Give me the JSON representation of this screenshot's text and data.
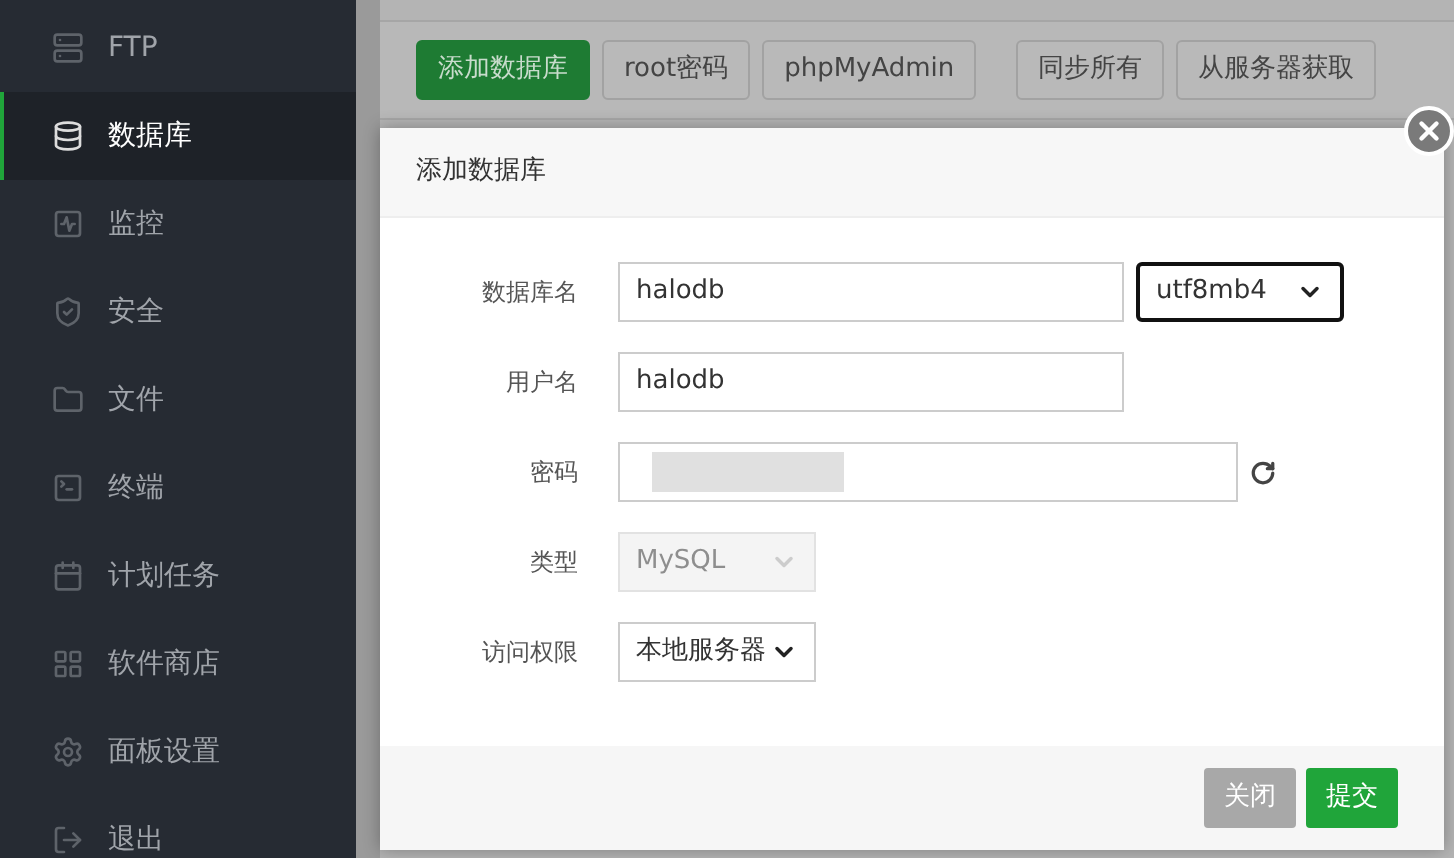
{
  "sidebar": {
    "items": [
      {
        "label": "FTP",
        "selected": false
      },
      {
        "label": "数据库",
        "selected": true
      },
      {
        "label": "监控",
        "selected": false
      },
      {
        "label": "安全",
        "selected": false
      },
      {
        "label": "文件",
        "selected": false
      },
      {
        "label": "终端",
        "selected": false
      },
      {
        "label": "计划任务",
        "selected": false
      },
      {
        "label": "软件商店",
        "selected": false
      },
      {
        "label": "面板设置",
        "selected": false
      },
      {
        "label": "退出",
        "selected": false
      }
    ]
  },
  "toolbar": {
    "groups": [
      [
        {
          "label": "添加数据库",
          "kind": "primary"
        },
        {
          "label": "root密码",
          "kind": "default"
        },
        {
          "label": "phpMyAdmin",
          "kind": "default"
        }
      ],
      [
        {
          "label": "同步所有",
          "kind": "default"
        },
        {
          "label": "从服务器获取",
          "kind": "default"
        }
      ]
    ]
  },
  "dialog": {
    "title": "添加数据库",
    "fields": [
      {
        "label": "数据库名",
        "kind": "text",
        "value": "halodb",
        "select": {
          "value": "utf8mb4",
          "disabled": false
        }
      },
      {
        "label": "用户名",
        "kind": "text",
        "value": "halodb"
      },
      {
        "label": "密码",
        "kind": "password"
      },
      {
        "label": "类型",
        "kind": "select",
        "value": "MySQL",
        "disabled": true
      },
      {
        "label": "访问权限",
        "kind": "select",
        "value": "本地服务器",
        "disabled": false
      }
    ],
    "buttons": [
      {
        "label": "关闭",
        "kind": "secondary"
      },
      {
        "label": "提交",
        "kind": "primary"
      }
    ]
  }
}
